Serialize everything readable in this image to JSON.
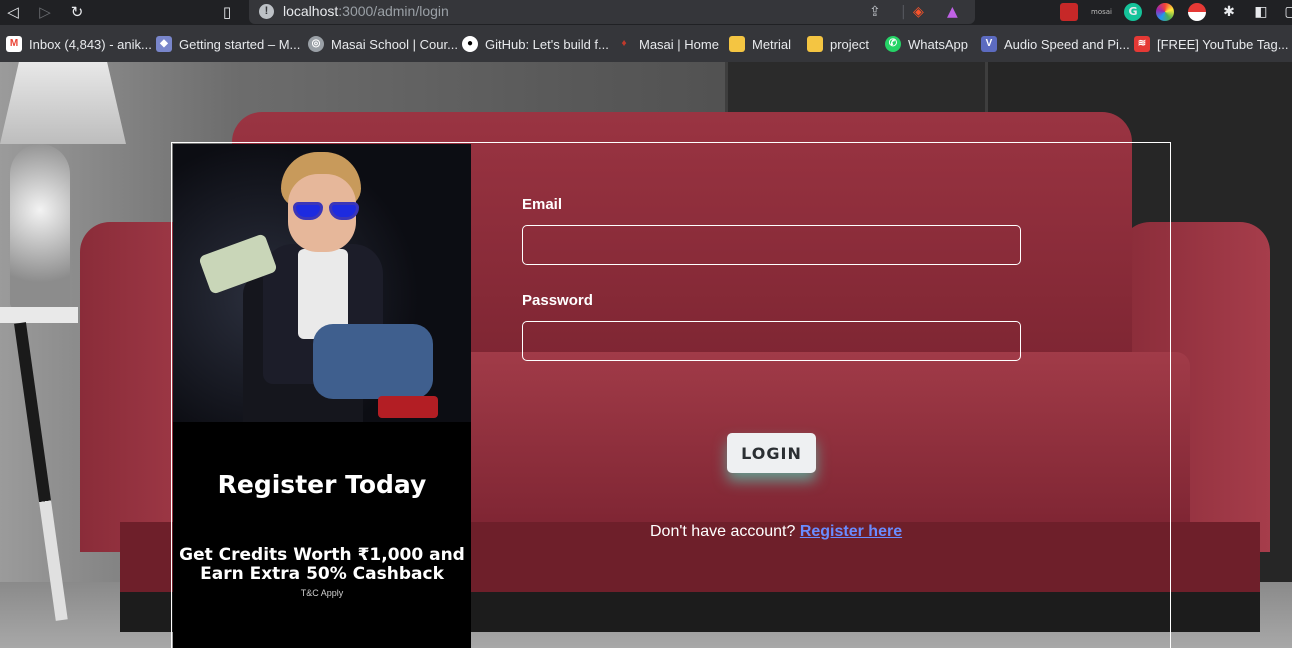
{
  "browser": {
    "url_host": "localhost",
    "url_rest": ":3000/admin/login",
    "extensions": [
      "mosai",
      "G"
    ],
    "bookmarks": [
      {
        "label": "Inbox (4,843) - anik...",
        "icon": "gmail-icon",
        "color": "#ea4335"
      },
      {
        "label": "Getting started – M...",
        "icon": "layers-icon",
        "color": "#7986cb"
      },
      {
        "label": "Masai School | Cour...",
        "icon": "globe-icon",
        "color": "#9aa0a6"
      },
      {
        "label": "GitHub: Let's build f...",
        "icon": "github-icon",
        "color": "#ffffff"
      },
      {
        "label": "Masai | Home",
        "icon": "masai-icon",
        "color": "#c0392b"
      },
      {
        "label": "Metrial",
        "icon": "folder-icon",
        "color": "#f4c542"
      },
      {
        "label": "project",
        "icon": "folder-icon",
        "color": "#f4c542"
      },
      {
        "label": "WhatsApp",
        "icon": "whatsapp-icon",
        "color": "#25d366"
      },
      {
        "label": "Audio Speed and Pi...",
        "icon": "v-icon",
        "color": "#5c6bc0"
      },
      {
        "label": "[FREE] YouTube Tag...",
        "icon": "youtube-tag-icon",
        "color": "#e53935"
      }
    ]
  },
  "promo": {
    "title": "Register Today",
    "offer_line1": "Get Credits Worth ₹1,000 and",
    "offer_line2": "Earn Extra 50% Cashback",
    "tc": "T&C Apply"
  },
  "form": {
    "email_label": "Email",
    "email_value": "",
    "password_label": "Password",
    "password_value": "",
    "login_button": "LOGIN",
    "register_prompt": "Don't have account?",
    "register_link": "Register here"
  }
}
